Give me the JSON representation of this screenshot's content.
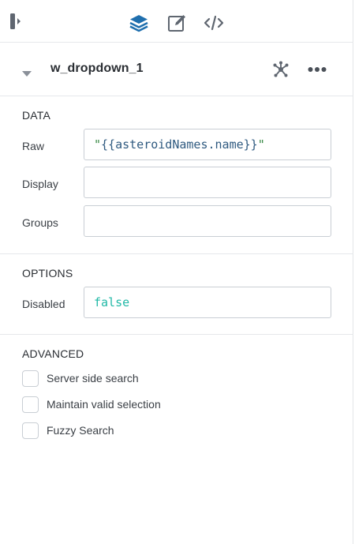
{
  "toolbar": {
    "icons": [
      "collapse-panel-icon",
      "layers-icon",
      "edit-icon",
      "code-icon"
    ],
    "accent_color": "#1f6fae"
  },
  "component": {
    "name": "w_dropdown_1",
    "icons": [
      "caret-down-icon",
      "dependency-graph-icon",
      "more-icon"
    ]
  },
  "data_section": {
    "title": "DATA",
    "raw_label": "Raw",
    "raw_open_quote": "\"",
    "raw_expression": "{{asteroidNames.name}}",
    "raw_close_quote": "\"",
    "display_label": "Display",
    "display_value": "",
    "groups_label": "Groups",
    "groups_value": ""
  },
  "options_section": {
    "title": "OPTIONS",
    "disabled_label": "Disabled",
    "disabled_value": "false"
  },
  "advanced_section": {
    "title": "ADVANCED",
    "checkboxes": [
      {
        "label": "Server side search",
        "checked": false
      },
      {
        "label": "Maintain valid selection",
        "checked": false
      },
      {
        "label": "Fuzzy Search",
        "checked": false
      }
    ]
  }
}
